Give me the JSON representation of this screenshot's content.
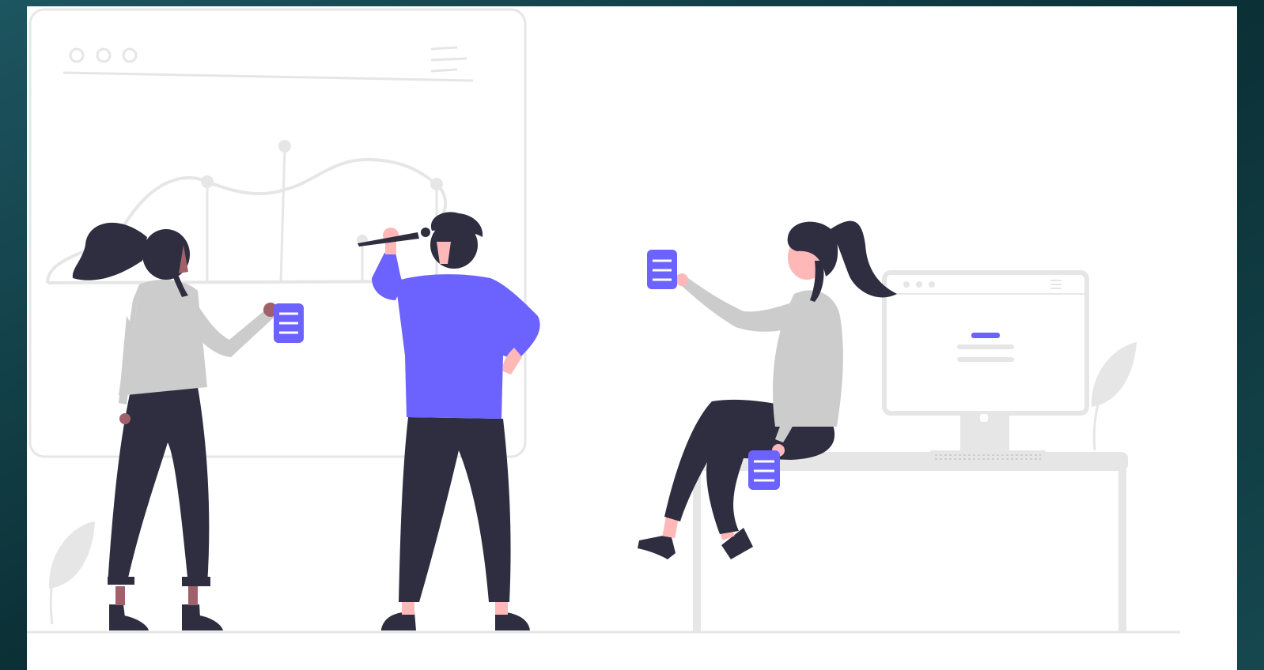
{
  "illustration": {
    "theme": "team-collaboration",
    "colors": {
      "background": "#0d3a42",
      "card": "#ffffff",
      "outline": "#e6e6e6",
      "accent": "#6c63ff",
      "dark": "#2f2e41",
      "shirt": "#cccccc",
      "skin_light": "#ffb8b8",
      "skin_dark": "#a0616a"
    },
    "icons": [
      "browser-window-icon",
      "line-chart-icon",
      "document-icon",
      "monitor-icon",
      "plant-icon",
      "desk-icon"
    ]
  }
}
